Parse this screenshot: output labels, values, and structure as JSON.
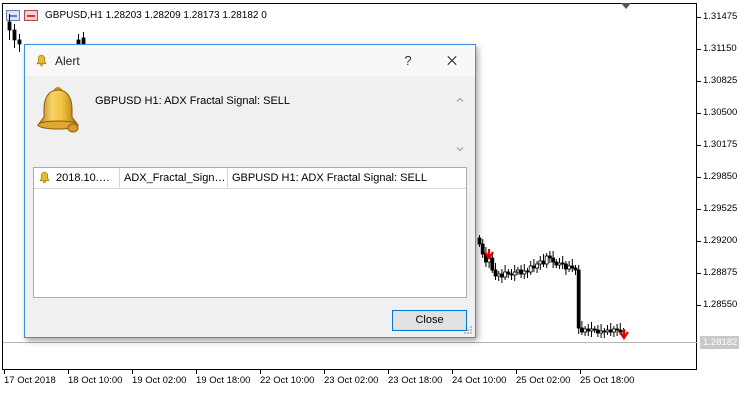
{
  "chart": {
    "header": "GBPUSD,H1  1.28203  1.28209  1.28173  1.28182  0",
    "price_labels": [
      "1.31475",
      "1.31150",
      "1.30825",
      "1.30500",
      "1.30175",
      "1.29850",
      "1.29525",
      "1.29200",
      "1.28875",
      "1.28550"
    ],
    "current_price": "1.28182",
    "time_labels": [
      "17 Oct 2018",
      "18 Oct 10:00",
      "19 Oct 02:00",
      "19 Oct 18:00",
      "22 Oct 10:00",
      "23 Oct 02:00",
      "23 Oct 18:00",
      "24 Oct 10:00",
      "25 Oct 02:00",
      "25 Oct 18:00"
    ],
    "colors": {
      "candle": "#000000",
      "signal_arrow": "#e00000",
      "bid_line": "#b8b8b8"
    }
  },
  "dialog": {
    "title": "Alert",
    "help_label": "?",
    "message": "GBPUSD H1: ADX Fractal Signal: SELL",
    "list_rows": [
      {
        "time": "2018.10.…",
        "expert": "ADX_Fractal_Sign…",
        "message": "GBPUSD H1: ADX Fractal Signal: SELL"
      }
    ],
    "close_label": "Close",
    "icons": {
      "title": "bell-icon",
      "big": "bell-icon",
      "row": "bell-icon"
    }
  }
}
